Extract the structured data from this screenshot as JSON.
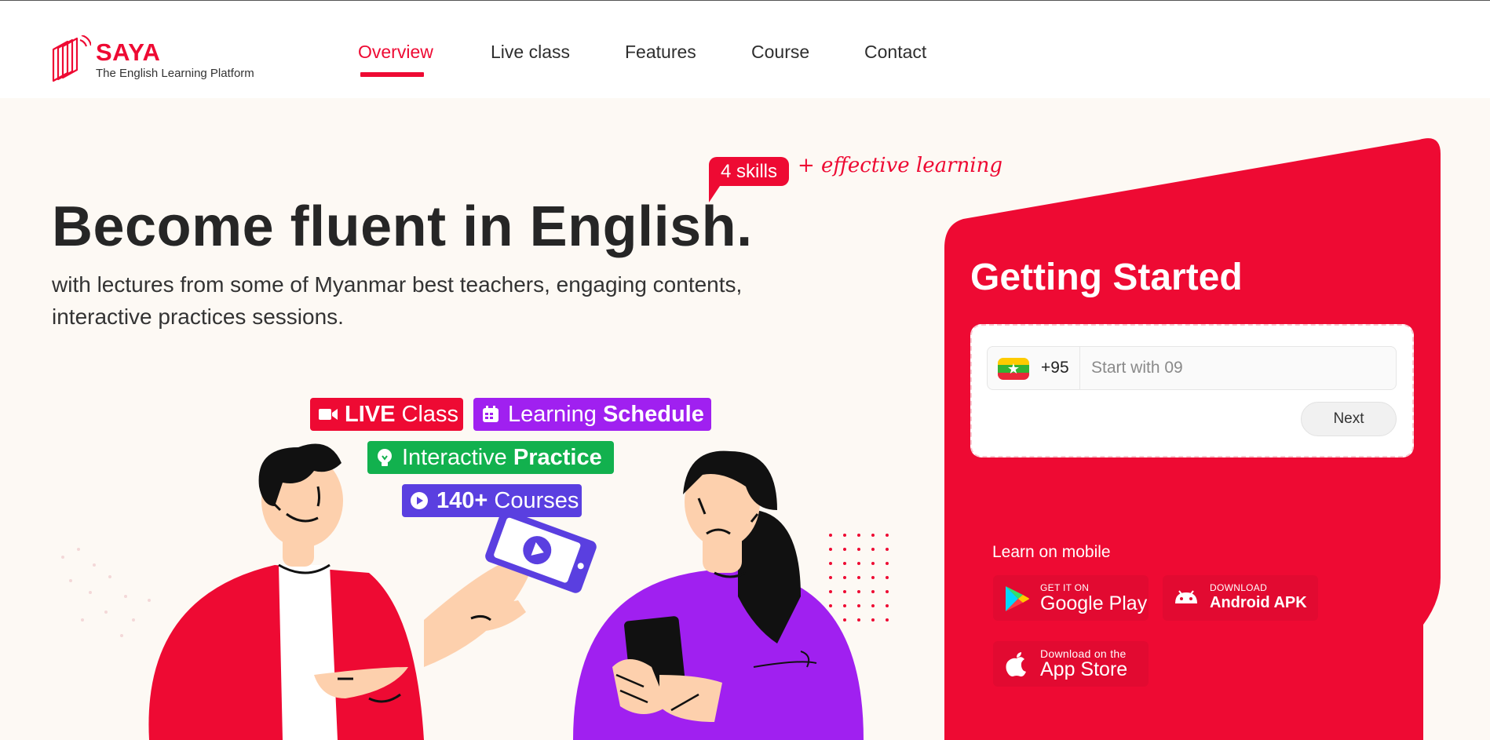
{
  "header": {
    "brand_name": "SAYA",
    "brand_tagline": "The English Learning Platform",
    "nav": [
      {
        "label": "Overview",
        "active": true
      },
      {
        "label": "Live class",
        "active": false
      },
      {
        "label": "Features",
        "active": false
      },
      {
        "label": "Course",
        "active": false
      },
      {
        "label": "Contact",
        "active": false
      }
    ]
  },
  "hero": {
    "skills_bubble": "4 skills",
    "skills_tagline": "+ effective learning",
    "title": "Become fluent in English.",
    "subtitle": "with lectures from some of Myanmar best teachers, engaging contents, interactive practices sessions."
  },
  "badges": {
    "live": {
      "bold": "LIVE",
      "text": "Class",
      "icon": "video-camera-icon"
    },
    "schedule": {
      "text": "Learning",
      "bold": "Schedule",
      "icon": "calendar-icon"
    },
    "practice": {
      "text": "Interactive",
      "bold": "Practice",
      "icon": "lightbulb-icon"
    },
    "courses": {
      "bold": "140+",
      "text": "Courses",
      "icon": "play-circle-icon"
    }
  },
  "signup": {
    "title": "Getting Started",
    "country_code": "+95",
    "phone_placeholder": "Start with 09",
    "next_label": "Next"
  },
  "mobile": {
    "heading": "Learn on mobile",
    "google_play": {
      "small": "GET IT ON",
      "big": "Google Play"
    },
    "android_apk": {
      "small": "DOWNLOAD",
      "big": "Android APK"
    },
    "app_store": {
      "small": "Download on the",
      "big": "App Store"
    }
  },
  "colors": {
    "brand_red": "#ee0a33",
    "purple": "#a020f0",
    "green": "#12b14e",
    "indigo": "#5a3fe0",
    "background": "#fdf9f4"
  }
}
